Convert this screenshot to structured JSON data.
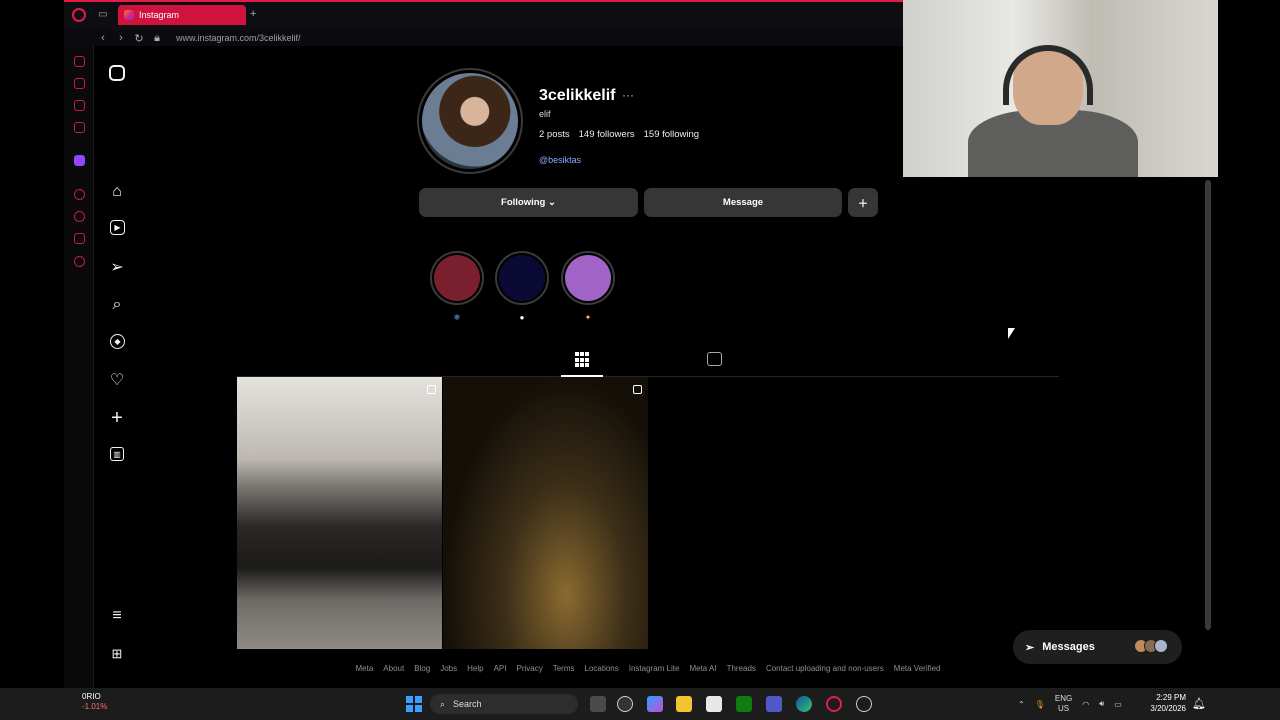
{
  "browser": {
    "tab_title": "Instagram",
    "url": "www.instagram.com/3celikkelif/"
  },
  "profile": {
    "username": "3celikkelif",
    "more": "···",
    "full_name": "elif",
    "posts": "2 posts",
    "followers": "149 followers",
    "following": "159 following",
    "handle": "@besiktas"
  },
  "buttons": {
    "following": "Following ⌄",
    "message": "Message",
    "add_user": "＋"
  },
  "highlights": [
    {
      "color": "#7a1f2e",
      "label": "❄"
    },
    {
      "color": "#0a0a35",
      "label": "●"
    },
    {
      "color": "#a263c7",
      "label": "✦"
    }
  ],
  "highlight_label_colors": [
    "#5ea8ff",
    "#ffffff",
    "#f5c542"
  ],
  "footer_links": [
    "Meta",
    "About",
    "Blog",
    "Jobs",
    "Help",
    "API",
    "Privacy",
    "Terms",
    "Locations",
    "Instagram Lite",
    "Meta AI",
    "Threads",
    "Contact uploading and non-users",
    "Meta Verified"
  ],
  "messages_label": "Messages",
  "taskbar": {
    "stock_name": "0RIO",
    "stock_change": "-1.01%",
    "search_placeholder": "Search",
    "lang1": "ENG",
    "lang2": "US",
    "time": "2:29 PM",
    "date": "3/20/2026"
  }
}
